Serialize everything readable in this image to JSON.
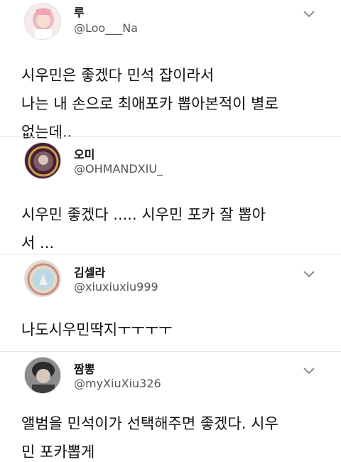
{
  "tweets": [
    {
      "name": "루",
      "handle": "@Loo___Na",
      "icon": "avatar-photo",
      "lines": [
        "시우민은 좋겠다 민석 잡이라서",
        "나는 내 손으로 최애포카 뽑아본적이 별로",
        "없는데.."
      ]
    },
    {
      "name": "오미",
      "handle": "@OHMANDXIU_",
      "icon": "avatar-seal",
      "lines": [
        "시우민 좋겠다 ..... 시우민 포카 잘 뽑아",
        "서 ..."
      ]
    },
    {
      "name": "김셀라",
      "handle": "@xiuxiuxiu999",
      "icon": "avatar-seal-light",
      "lines": [
        "나도시우민딱지ㅜㅜㅜㅜ"
      ]
    },
    {
      "name": "짬뽕",
      "handle": "@myXiuXiu326",
      "icon": "avatar-photo",
      "lines": [
        "앨범을 민석이가 선택해주면 좋겠다. 시우",
        "민 포카뽑게"
      ]
    }
  ],
  "colors": {
    "text": "#111111",
    "handle": "#555555",
    "chevron": "#8a8a8a"
  }
}
